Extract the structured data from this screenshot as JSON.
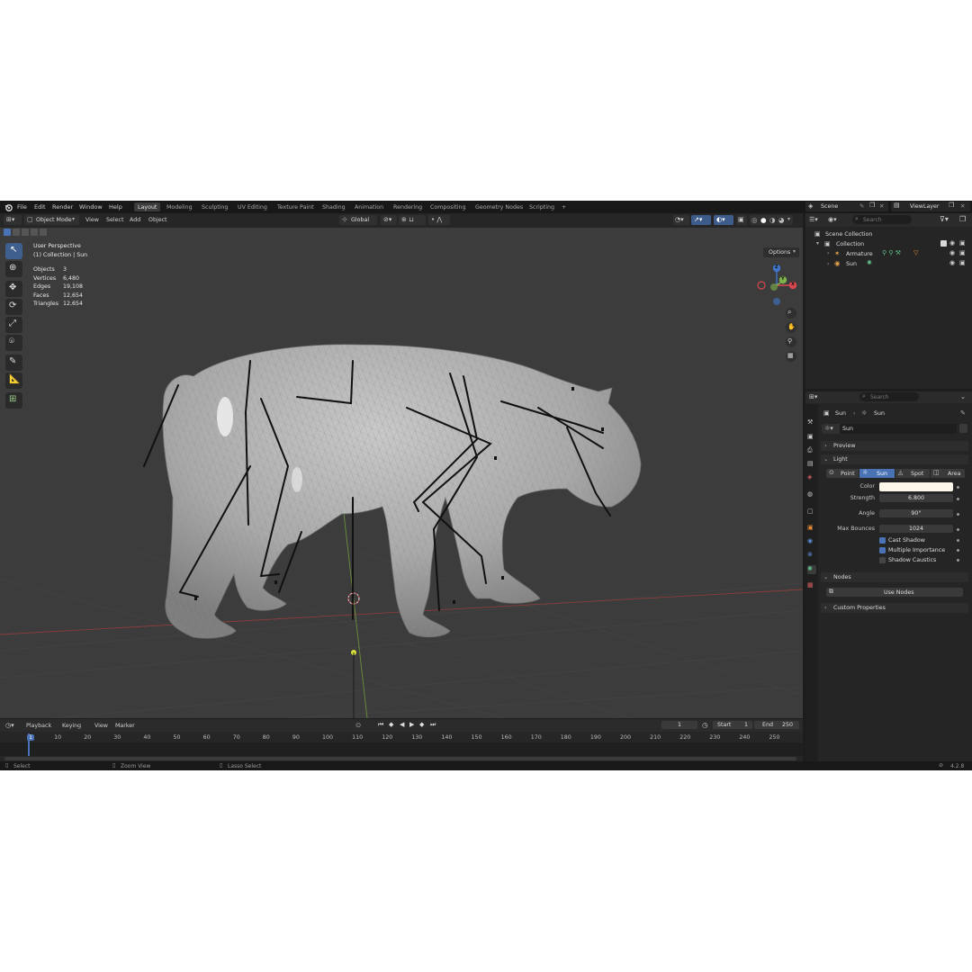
{
  "menubar": {
    "items": [
      "File",
      "Edit",
      "Render",
      "Window",
      "Help"
    ],
    "workspaces": [
      "Layout",
      "Modeling",
      "Sculpting",
      "UV Editing",
      "Texture Paint",
      "Shading",
      "Animation",
      "Rendering",
      "Compositing",
      "Geometry Nodes",
      "Scripting",
      "+"
    ],
    "scene": "Scene",
    "view_layer": "ViewLayer"
  },
  "viewport_header": {
    "mode": "Object Mode",
    "menus": [
      "View",
      "Select",
      "Add",
      "Object"
    ],
    "orientation": "Global",
    "options": "Options"
  },
  "overlay": {
    "perspective": "User Perspective",
    "collection": "(1) Collection | Sun",
    "stats": [
      {
        "label": "Objects",
        "value": "3"
      },
      {
        "label": "Vertices",
        "value": "6,480"
      },
      {
        "label": "Edges",
        "value": "19,108"
      },
      {
        "label": "Faces",
        "value": "12,654"
      },
      {
        "label": "Triangles",
        "value": "12,654"
      }
    ]
  },
  "gizmo": {
    "x": "X",
    "y": "Y",
    "z": "Z"
  },
  "outliner": {
    "search_placeholder": "Search",
    "scene_collection": "Scene Collection",
    "collection": "Collection",
    "items": [
      "Armature",
      "Sun"
    ]
  },
  "properties": {
    "search_placeholder": "Search",
    "breadcrumb_obj": "Sun",
    "breadcrumb_data": "Sun",
    "datablock": "Sun",
    "sections": {
      "preview": "Preview",
      "light": "Light",
      "nodes": "Nodes",
      "custom": "Custom Properties"
    },
    "light_types": [
      "Point",
      "Sun",
      "Spot",
      "Area"
    ],
    "active_light_type": "Sun",
    "color_label": "Color",
    "color_value": "#fdf6ea",
    "strength_label": "Strength",
    "strength_value": "6.800",
    "angle_label": "Angle",
    "angle_value": "90°",
    "bounces_label": "Max Bounces",
    "bounces_value": "1024",
    "cast_shadow": "Cast Shadow",
    "multiple_importance": "Multiple Importance",
    "shadow_caustics": "Shadow Caustics",
    "use_nodes": "Use Nodes"
  },
  "timeline": {
    "menus": [
      "Playback",
      "Keying",
      "View",
      "Marker"
    ],
    "current_frame": "1",
    "start_label": "Start",
    "start_value": "1",
    "end_label": "End",
    "end_value": "250",
    "ticks": [
      "1",
      "10",
      "20",
      "30",
      "40",
      "50",
      "60",
      "70",
      "80",
      "90",
      "100",
      "110",
      "120",
      "130",
      "140",
      "150",
      "160",
      "170",
      "180",
      "190",
      "200",
      "210",
      "220",
      "230",
      "240",
      "250"
    ]
  },
  "statusbar": {
    "select": "Select",
    "zoom": "Zoom View",
    "lasso": "Lasso Select",
    "version": "4.2.8"
  },
  "colors": {
    "accent": "#4a73b5",
    "x_axis": "#d9464f",
    "y_axis": "#7fb24a",
    "z_axis": "#3f76c9"
  }
}
